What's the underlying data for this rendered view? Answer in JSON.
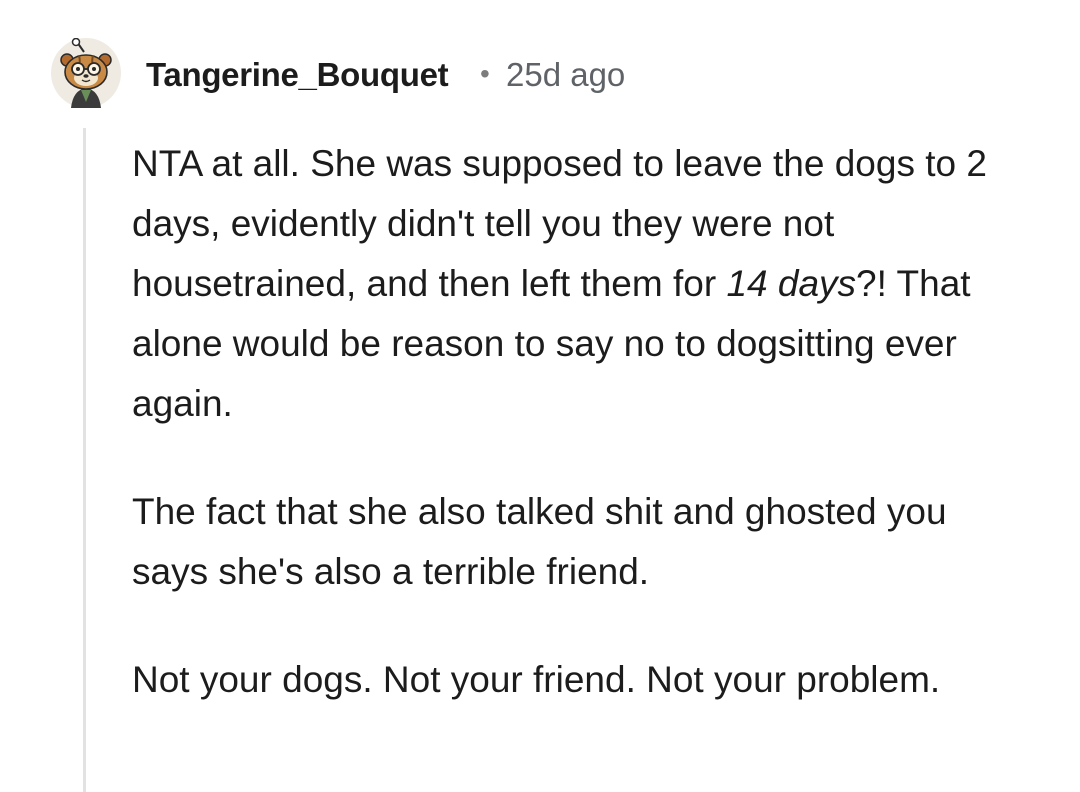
{
  "comment": {
    "author": "Tangerine_Bouquet",
    "separator": "•",
    "timestamp": "25d ago",
    "avatar_icon": "snoo-avatar-icon",
    "paragraphs": [
      {
        "before": "NTA at all. She was supposed to leave the dogs to 2 days, evidently didn't tell you they were not housetrained, and then left them for ",
        "emphasis": "14 days",
        "after": "?! That alone would be reason to say no to dogsitting ever again."
      },
      {
        "text": "The fact that she also talked shit and ghosted you says she's also a terrible friend."
      },
      {
        "text": "Not your dogs. Not your friend. Not your problem."
      }
    ]
  },
  "colors": {
    "text": "#1c1c1c",
    "meta": "#5f6368",
    "thread_line": "#e2e2e2",
    "avatar_background": "#f0ece4"
  }
}
